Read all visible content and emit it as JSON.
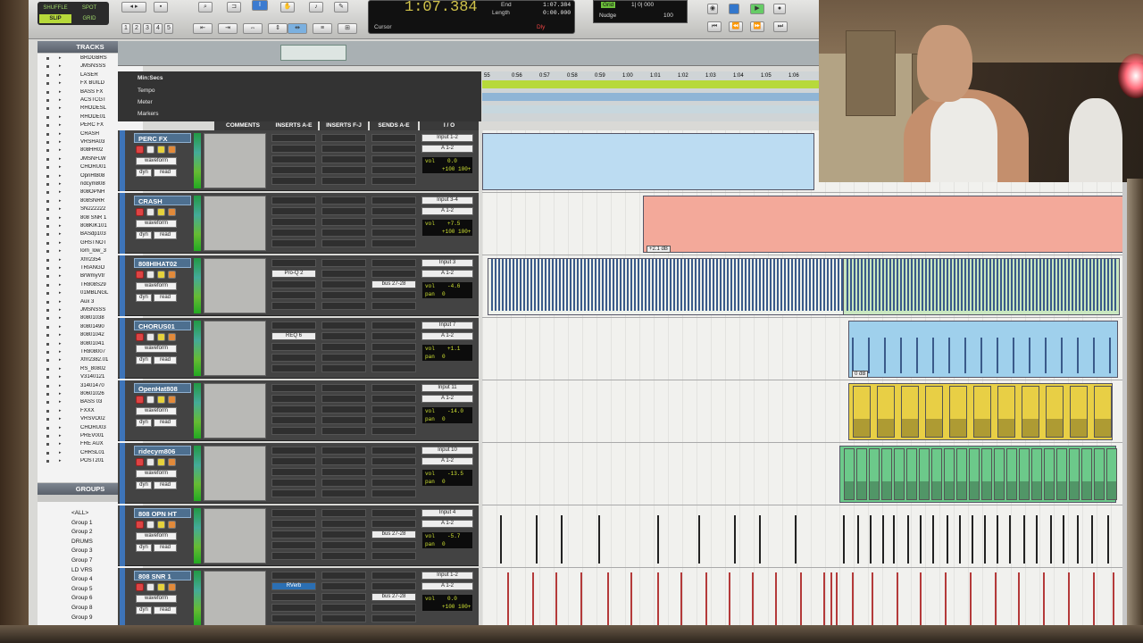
{
  "toolbar": {
    "modes": [
      "SHUFFLE",
      "SPOT",
      "SLIP",
      "GRID"
    ],
    "numbers": [
      "1",
      "2",
      "3",
      "4",
      "5"
    ],
    "counter_main": "1:07.384",
    "end_label": "End",
    "end_value": "1:07.384",
    "length_label": "Length",
    "length_value": "0:00.000",
    "cursor_label": "Cursor",
    "dly_label": "Dly",
    "grid_label": "Grid",
    "grid_value": "1| 0| 000",
    "nudge_label": "Nudge",
    "nudge_value": "100"
  },
  "left": {
    "tracks_header": "TRACKS",
    "tracks": [
      "BRDGBRS",
      "JMSNSSS",
      "LASER",
      "FX BUILD",
      "BASS FX",
      "ACSTCGT",
      "RHODESL",
      "RHODE01",
      "PERC FX",
      "CRASH",
      "VRSHA03",
      "808HH02",
      "JMSNFLW",
      "CHORU01",
      "OpnHt808",
      "ridcym808",
      "808OPNH",
      "808SNRR",
      "SN222222",
      "808 SNR 1",
      "808KIK101",
      "BASdp103",
      "GHSTNOT",
      "lorn_low_3",
      "Xfrr2354",
      "TRIANGO",
      "BrWmyVtr",
      "TR808S29",
      "01MBLNGL",
      "Aux 3",
      "JMSNSSS",
      "80801038",
      "80801490",
      "80801042",
      "80801041",
      "TR808007",
      "Xfrr2382.01",
      "RS_80802",
      "V3140121",
      "31401470",
      "80601026",
      "BASS 03",
      "FXXX",
      "VRSVO02",
      "CHORU03",
      "PREV001",
      "FRE AUX",
      "CHRSL01",
      "POST201"
    ],
    "groups_header": "GROUPS",
    "groups": [
      "<ALL>",
      "Group 1",
      "Group 2",
      "DRUMS",
      "Group 3",
      "Group 7",
      "LD VRS",
      "Group 4",
      "Group 5",
      "Group 6",
      "Group 8",
      "Group 9"
    ]
  },
  "rulers": {
    "labels": [
      "Min:Secs",
      "Tempo",
      "Meter",
      "Markers"
    ],
    "ticks": [
      "55",
      "0:56",
      "0:57",
      "0:58",
      "0:59",
      "1:00",
      "1:01",
      "1:02",
      "1:03",
      "1:04",
      "1:05",
      "1:06"
    ]
  },
  "mix_headers": [
    "COMMENTS",
    "INSERTS A-E",
    "INSERTS F-J",
    "SENDS A-E",
    "I / O"
  ],
  "tracks": [
    {
      "name": "PERC FX",
      "view": "waveform",
      "dyn": "dyn",
      "read": "read",
      "insert": "",
      "send": "",
      "input": "Input 1-2",
      "output": "A 1-2",
      "vol_label": "vol",
      "vol": "0.0",
      "pan_label": "",
      "pan": "+100  100+",
      "clip_color": "#bcdcf2",
      "clip_label": ""
    },
    {
      "name": "CRASH",
      "view": "waveform",
      "dyn": "dyn",
      "read": "read",
      "insert": "",
      "send": "",
      "input": "Input 3-4",
      "output": "A 1-2",
      "vol_label": "vol",
      "vol": "+7.5",
      "pan_label": "",
      "pan": "+100  100+",
      "clip_color": "#f3a99a",
      "clip_label": "+2.1 dB"
    },
    {
      "name": "808HIHAT02",
      "view": "waveform",
      "dyn": "dyn",
      "read": "read",
      "insert": "Pro-Q 2",
      "send": "bus 27-28",
      "input": "Input 3",
      "output": "A 1-2",
      "vol_label": "vol",
      "vol": "-4.6",
      "pan_label": "pan",
      "pan": "0",
      "clip_color": "#c9e7c0",
      "clip_label": ""
    },
    {
      "name": "CHORUS01",
      "view": "waveform",
      "dyn": "dyn",
      "read": "read",
      "insert": "REQ 6",
      "send": "",
      "input": "Input 7",
      "output": "A 1-2",
      "vol_label": "vol",
      "vol": "+1.1",
      "pan_label": "pan",
      "pan": "0",
      "clip_color": "#9fd0ec",
      "clip_label": "0 dB"
    },
    {
      "name": "OpenHat808",
      "view": "waveform",
      "dyn": "dyn",
      "read": "read",
      "insert": "",
      "send": "",
      "input": "Input 11",
      "output": "A 1-2",
      "vol_label": "vol",
      "vol": "-14.0",
      "pan_label": "pan",
      "pan": "0",
      "clip_color": "#e8cf45",
      "clip_label": ""
    },
    {
      "name": "ridecym806",
      "view": "waveform",
      "dyn": "dyn",
      "read": "read",
      "insert": "",
      "send": "",
      "input": "Input 10",
      "output": "A 1-2",
      "vol_label": "vol",
      "vol": "-13.5",
      "pan_label": "pan",
      "pan": "0",
      "clip_color": "#6cc98a",
      "clip_label": ""
    },
    {
      "name": "808 OPN HT",
      "view": "waveform",
      "dyn": "dyn",
      "read": "read",
      "insert": "",
      "send": "bus 27-28",
      "input": "Input 4",
      "output": "A 1-2",
      "vol_label": "vol",
      "vol": "-5.7",
      "pan_label": "pan",
      "pan": "0",
      "clip_color": "#f0f0ee",
      "clip_label": ""
    },
    {
      "name": "808 SNR 1",
      "view": "waveform",
      "dyn": "dyn",
      "read": "read",
      "insert": "RVerb",
      "send": "bus 27-28",
      "input": "Input 1-2",
      "output": "A 1-2",
      "vol_label": "vol",
      "vol": "0.0",
      "pan_label": "",
      "pan": "+100  100+",
      "clip_color": "#f0f0ee",
      "clip_label": ""
    }
  ],
  "colors": {
    "accent": "#b7d93a",
    "track_name": "#4d6f8f",
    "counter": "#d0c24a"
  }
}
